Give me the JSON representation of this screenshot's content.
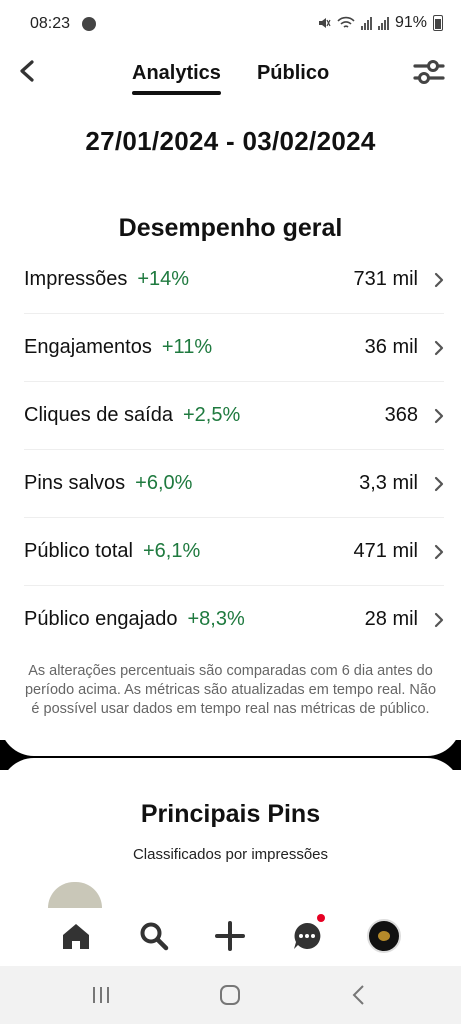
{
  "status_bar": {
    "time": "08:23",
    "battery": "91%"
  },
  "header": {
    "tabs": [
      {
        "label": "Analytics",
        "active": true
      },
      {
        "label": "Público",
        "active": false
      }
    ]
  },
  "date_range": "27/01/2024 - 03/02/2024",
  "overview": {
    "title": "Desempenho geral",
    "metrics": [
      {
        "label": "Impressões",
        "change": "+14%",
        "value": "731 mil"
      },
      {
        "label": "Engajamentos",
        "change": "+11%",
        "value": "36 mil"
      },
      {
        "label": "Cliques de saída",
        "change": "+2,5%",
        "value": "368"
      },
      {
        "label": "Pins salvos",
        "change": "+6,0%",
        "value": "3,3 mil"
      },
      {
        "label": "Público total",
        "change": "+6,1%",
        "value": "471 mil"
      },
      {
        "label": "Público engajado",
        "change": "+8,3%",
        "value": "28 mil"
      }
    ],
    "note": "As alterações percentuais são comparadas com 6 dia antes do período acima. As métricas são atualizadas em tempo real. Não é possível usar dados em tempo real nas métricas de público."
  },
  "top_pins": {
    "title": "Principais Pins",
    "subtitle": "Classificados por impressões"
  },
  "colors": {
    "positive": "#1f7a3f",
    "notification": "#e60023"
  },
  "icons": [
    "back-arrow-icon",
    "filter-sliders-icon",
    "home-icon",
    "search-icon",
    "plus-icon",
    "messages-icon",
    "chevron-right-icon"
  ]
}
